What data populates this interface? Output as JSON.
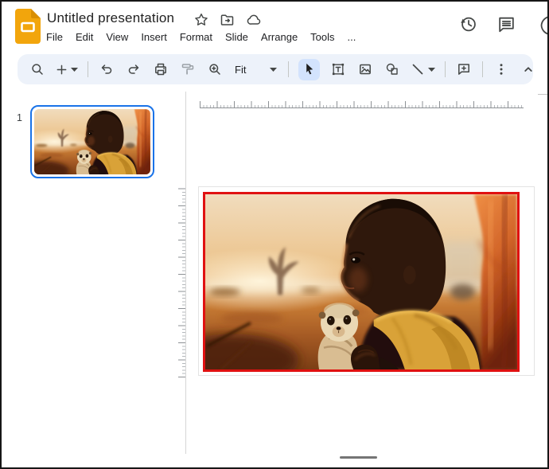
{
  "app": {
    "name": "Google Slides"
  },
  "header": {
    "title": "Untitled presentation",
    "title_action_icons": [
      "star-icon",
      "move-folder-icon",
      "cloud-saved-icon"
    ],
    "menu_items": [
      "File",
      "Edit",
      "View",
      "Insert",
      "Format",
      "Slide",
      "Arrange",
      "Tools",
      "..."
    ],
    "right_icons": [
      "version-history-icon",
      "comments-icon",
      "partial-edge-icon"
    ]
  },
  "toolbar": {
    "zoom_fit_label": "Fit",
    "selected_tool": "select-cursor",
    "button_icons": [
      "search-icon",
      "plus-icon",
      "caret-down-icon",
      "undo-icon",
      "redo-icon",
      "print-icon",
      "paint-format-icon",
      "zoom-in-icon",
      "fit-dropdown",
      "select-cursor-icon",
      "text-box-icon",
      "insert-image-icon",
      "insert-shape-icon",
      "insert-line-icon",
      "insert-comment-icon",
      "more-vertical-icon",
      "hide-menus-icon"
    ]
  },
  "filmstrip": {
    "slide_number": "1",
    "selected": true
  },
  "slide": {
    "image_alt": "Child in yellow shawl holding a meerkat pup at sunset in a savanna",
    "image_border_color": "#e01111"
  },
  "colors": {
    "toolbar_bg": "#edf2fa",
    "selected_tool_bg": "#d3e3fd",
    "accent_blue": "#1a73e8",
    "image_border_red": "#e01111",
    "logo_yellow": "#f2a50c"
  }
}
